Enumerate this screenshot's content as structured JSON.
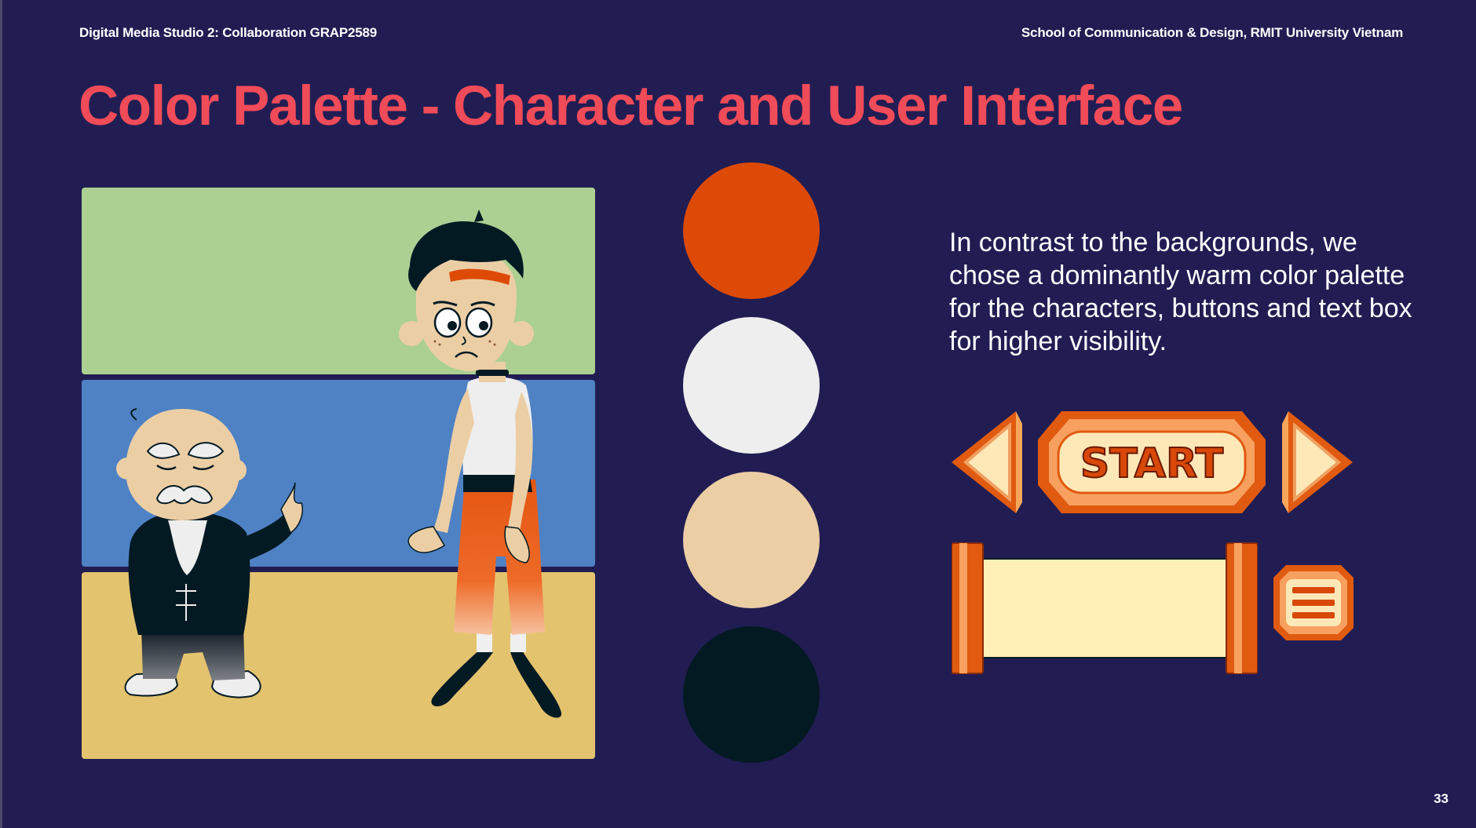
{
  "header": {
    "course": "Digital Media Studio 2: Collaboration GRAP2589",
    "school": "School of Communication & Design, RMIT University Vietnam"
  },
  "slide": {
    "title": "Color Palette - Character and User Interface",
    "description": "In contrast to the backgrounds, we chose a dominantly warm color palette for the characters, buttons and text box for higher visibility.",
    "page_number": "33"
  },
  "background_bands": [
    "#abd092",
    "#4f82c4",
    "#e3c36e"
  ],
  "palette": [
    {
      "name": "orange",
      "hex": "#dd4a06"
    },
    {
      "name": "off-white",
      "hex": "#eeeeee"
    },
    {
      "name": "skin-beige",
      "hex": "#eccea5"
    },
    {
      "name": "dark-navy",
      "hex": "#041a23"
    }
  ],
  "ui_elements": {
    "start_label": "START",
    "icons": [
      "arrow-left-icon",
      "start-button",
      "arrow-right-icon",
      "scroll-textbox",
      "menu-icon"
    ]
  },
  "colors": {
    "background": "#211d53",
    "title": "#f04b58",
    "text": "#ffffff"
  }
}
